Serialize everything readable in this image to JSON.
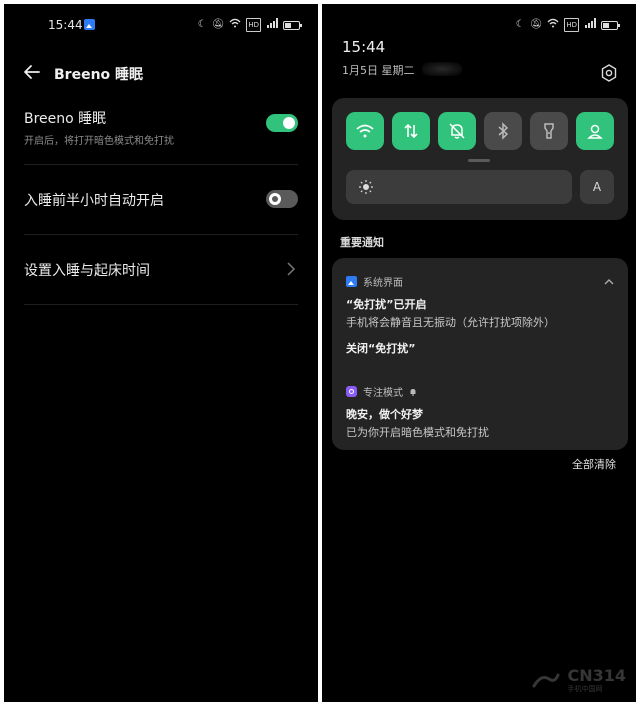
{
  "left_screen": {
    "status_time": "15:44",
    "header": {
      "title": "Breeno 睡眠"
    },
    "settings": [
      {
        "label": "Breeno 睡眠",
        "subtitle": "开启后，将打开暗色模式和免打扰",
        "toggle": "on"
      },
      {
        "label": "入睡前半小时自动开启",
        "toggle": "off"
      },
      {
        "label": "设置入睡与起床时间"
      }
    ]
  },
  "right_screen": {
    "status_time": "15:44",
    "date": "1月5日  星期二",
    "quick_settings": [
      {
        "icon": "wifi-icon",
        "state": "on"
      },
      {
        "icon": "mobile-data-icon",
        "state": "on"
      },
      {
        "icon": "do-not-disturb-icon",
        "state": "on"
      },
      {
        "icon": "bluetooth-icon",
        "state": "off"
      },
      {
        "icon": "flashlight-icon",
        "state": "off"
      },
      {
        "icon": "hotspot-icon",
        "state": "on"
      }
    ],
    "brightness": {
      "auto_label": "A"
    },
    "section_title": "重要通知",
    "notifications": [
      {
        "app": "系统界面",
        "title": "“免打扰”已开启",
        "body": "手机将会静音且无振动（允许打扰项除外）",
        "action": "关闭“免打扰”"
      },
      {
        "app": "专注模式",
        "title": "晚安，做个好梦",
        "body": "已为你开启暗色模式和免打扰"
      }
    ],
    "clear_all": "全部清除"
  },
  "watermark": {
    "text": "CN314",
    "sub": "手机中国网"
  },
  "colors": {
    "accent": "#31c27c",
    "background": "#000000",
    "card": "#242424"
  }
}
